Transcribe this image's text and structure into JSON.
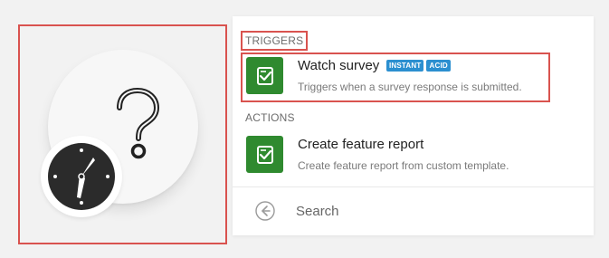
{
  "triggers": {
    "section_label": "TRIGGERS",
    "items": [
      {
        "title": "Watch survey",
        "badges": [
          "INSTANT",
          "ACID"
        ],
        "description": "Triggers when a survey response is submitted."
      }
    ]
  },
  "actions": {
    "section_label": "ACTIONS",
    "items": [
      {
        "title": "Create feature report",
        "description": "Create feature report from custom template."
      }
    ]
  },
  "search": {
    "label": "Search"
  },
  "colors": {
    "app_tile": "#2f8a2f",
    "badge": "#2b8fd0",
    "highlight_border": "#d9534f",
    "clock_face": "#2b2b2b"
  },
  "icons": {
    "module": "question-mark-icon",
    "schedule": "clock-icon",
    "app": "checklist-icon",
    "back": "back-arrow-icon"
  }
}
